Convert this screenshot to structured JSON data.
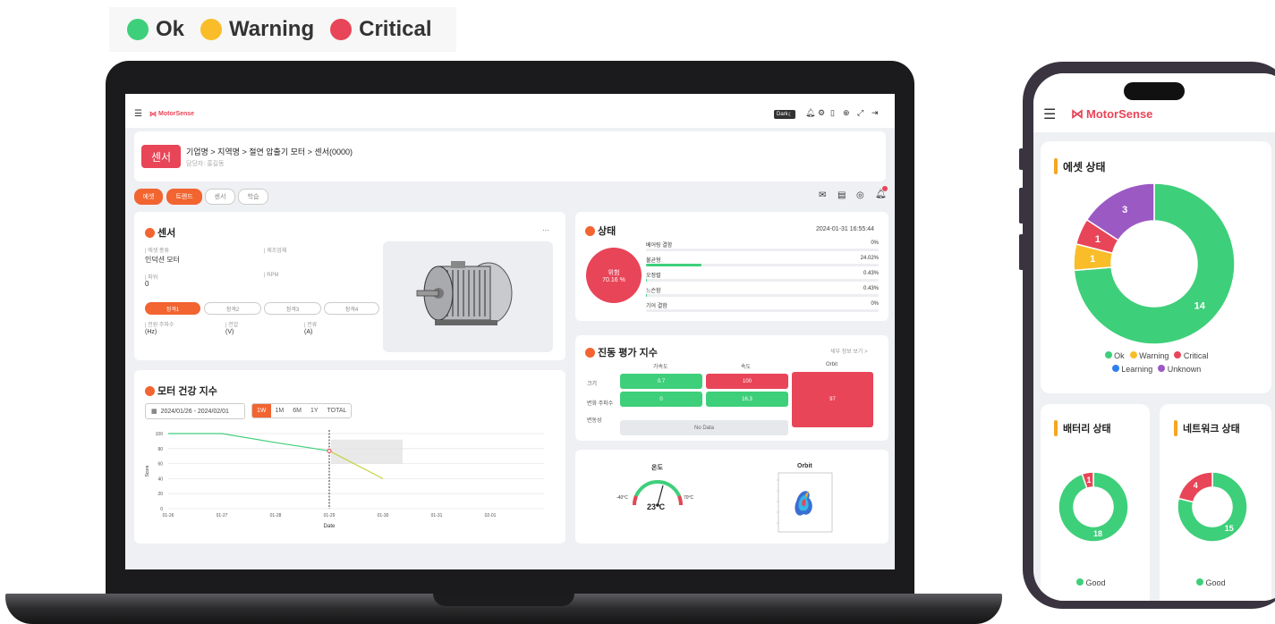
{
  "legend": [
    {
      "label": "Ok",
      "color": "#3ecf7a"
    },
    {
      "label": "Warning",
      "color": "#f9bd2a"
    },
    {
      "label": "Critical",
      "color": "#e84558"
    }
  ],
  "app": {
    "brand": "MotorSense",
    "dark_toggle": "Dark"
  },
  "header": {
    "badge": "센서",
    "breadcrumb": "기업명 > 지역명 > 절연 압출기 모터 > 센서(0000)",
    "manager": "담당자: 홍길동"
  },
  "tabs": [
    "에셋",
    "트렌드",
    "센서",
    "학습"
  ],
  "sensor_card": {
    "title": "센서",
    "more": "···",
    "fields": [
      {
        "label": "| 에셋 종류",
        "value": "인덕션 모터"
      },
      {
        "label": "| 제조업체",
        "value": ""
      },
      {
        "label": "| 파워",
        "value": "0"
      },
      {
        "label": "| RPM",
        "value": ""
      }
    ],
    "rated_tabs": [
      "정격1",
      "정격2",
      "정격3",
      "정격4"
    ],
    "rated_fields": [
      {
        "label": "| 전원 주파수",
        "value": "(Hz)"
      },
      {
        "label": "| 전압",
        "value": "(V)"
      },
      {
        "label": "| 전류",
        "value": "(A)"
      }
    ]
  },
  "status_card": {
    "title": "상태",
    "timestamp": "2024-01-31 16:55:44",
    "gauge_label": "위험",
    "gauge_value": "70.16 %",
    "rows": [
      {
        "label": "베어링 결함",
        "value": "0%",
        "pct": 0
      },
      {
        "label": "불균형",
        "value": "24.02%",
        "pct": 24.02
      },
      {
        "label": "오정렬",
        "value": "0.43%",
        "pct": 0.43
      },
      {
        "label": "느슨함",
        "value": "0.43%",
        "pct": 0.43
      },
      {
        "label": "기어 결함",
        "value": "0%",
        "pct": 0
      }
    ]
  },
  "health_card": {
    "title": "모터 건강 지수",
    "date_range": "2024/01/26 - 2024/02/01",
    "ranges": [
      "1W",
      "1M",
      "6M",
      "1Y",
      "TOTAL"
    ],
    "chart_data": {
      "type": "line",
      "x": [
        "01-26",
        "01-27",
        "01-28",
        "01-29",
        "01-30",
        "01-31",
        "02-01"
      ],
      "ylabel": "Score",
      "xlabel": "Date",
      "ylim": [
        0,
        100
      ],
      "yticks": [
        0,
        20,
        40,
        60,
        80,
        100
      ],
      "series": [
        {
          "values": [
            100,
            100,
            88,
            77,
            null,
            null,
            null
          ],
          "color": "#3ecf7a"
        },
        {
          "values": [
            null,
            null,
            null,
            77,
            40,
            null,
            null
          ],
          "color": "#c6d13f"
        }
      ]
    }
  },
  "vibration_card": {
    "title": "진동 평가 지수",
    "detail_link": "세부 정보 보기 >",
    "columns": [
      "가속도",
      "속도",
      "Orbit"
    ],
    "rows": [
      {
        "label": "크기",
        "cells": [
          {
            "value": "0.7",
            "color": "#3ecf7a"
          },
          {
            "value": "100",
            "color": "#e84558"
          }
        ]
      },
      {
        "label": "변화 주파수",
        "cells": [
          {
            "value": "0",
            "color": "#3ecf7a"
          },
          {
            "value": "16.3",
            "color": "#3ecf7a"
          }
        ]
      },
      {
        "label": "변동성",
        "cells": [
          {
            "value": "No Data",
            "color": "#e6e8ec"
          }
        ]
      }
    ],
    "orbit_value": "97"
  },
  "temp_card": {
    "title": "온도",
    "min": "-40°C",
    "max": "70°C",
    "value": "23°C",
    "orbit_title": "Orbit"
  },
  "phone": {
    "brand": "MotorSense",
    "asset_title": "에셋 상태",
    "asset_donut": {
      "type": "pie",
      "slices": [
        {
          "label": "Ok",
          "value": 14,
          "color": "#3ecf7a"
        },
        {
          "label": "Warning",
          "value": 1,
          "color": "#f9bd2a"
        },
        {
          "label": "Critical",
          "value": 1,
          "color": "#e84558"
        },
        {
          "label": "Unknown",
          "value": 3,
          "color": "#9b59c4"
        }
      ]
    },
    "asset_legend": [
      {
        "label": "Ok",
        "color": "#3ecf7a"
      },
      {
        "label": "Warning",
        "color": "#f9bd2a"
      },
      {
        "label": "Critical",
        "color": "#e84558"
      },
      {
        "label": "Learning",
        "color": "#2f80ed"
      },
      {
        "label": "Unknown",
        "color": "#9b59c4"
      }
    ],
    "battery_title": "배터리 상태",
    "battery_donut": {
      "type": "pie",
      "slices": [
        {
          "label": "Good",
          "value": 18,
          "color": "#3ecf7a"
        },
        {
          "value": 1,
          "color": "#e84558"
        }
      ]
    },
    "network_title": "네트워크 상태",
    "network_donut": {
      "type": "pie",
      "slices": [
        {
          "label": "Good",
          "value": 15,
          "color": "#3ecf7a"
        },
        {
          "value": 4,
          "color": "#e84558"
        }
      ]
    },
    "good_label": "Good"
  }
}
